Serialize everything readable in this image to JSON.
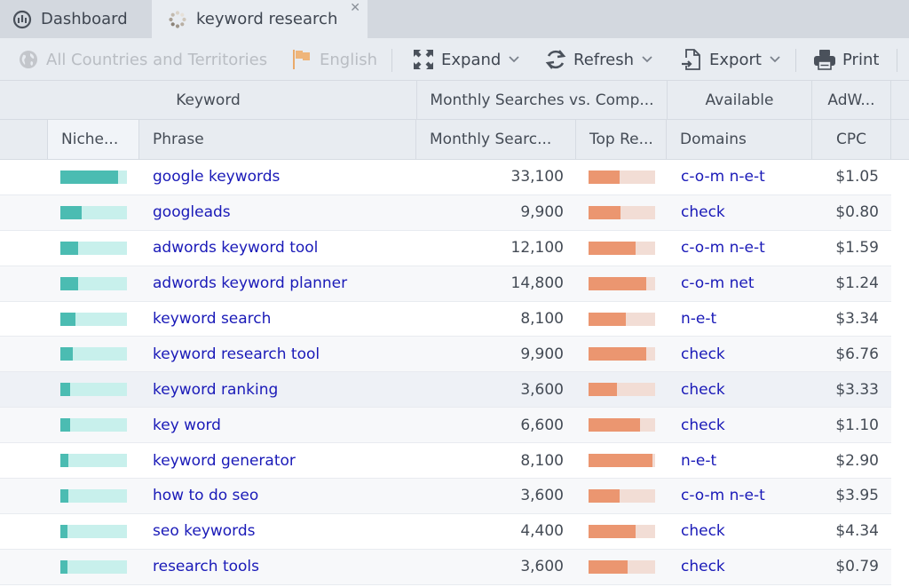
{
  "tabs": [
    {
      "label": "Dashboard",
      "icon": "dashboard-gauge-icon",
      "active": false
    },
    {
      "label": "keyword research",
      "icon": "loading-spinner-icon",
      "active": true,
      "closable": true
    }
  ],
  "toolbar": {
    "country": {
      "label": "All Countries and Territories",
      "icon": "globe-icon",
      "enabled": false
    },
    "language": {
      "label": "English",
      "icon": "flag-icon",
      "enabled": false
    },
    "expand": {
      "label": "Expand",
      "icon": "expand-arrows-icon",
      "has_dropdown": true
    },
    "refresh": {
      "label": "Refresh",
      "icon": "refresh-icon",
      "has_dropdown": true
    },
    "export": {
      "label": "Export",
      "icon": "export-file-icon",
      "has_dropdown": true
    },
    "print": {
      "label": "Print",
      "icon": "printer-icon",
      "has_dropdown": false
    }
  },
  "table": {
    "group_headers": [
      "Keyword",
      "Monthly Searches vs. Comp...",
      "Available",
      "AdW..."
    ],
    "columns": [
      "Niche...",
      "Phrase",
      "Monthly Searc...",
      "Top Re...",
      "Domains",
      "CPC"
    ],
    "selected_row": 6,
    "rows": [
      {
        "niche": 0.87,
        "phrase": "google keywords",
        "searches": "33,100",
        "top": 0.46,
        "domains": "c-o-m n-e-t",
        "cpc": "$1.05"
      },
      {
        "niche": 0.32,
        "phrase": "googleads",
        "searches": "9,900",
        "top": 0.48,
        "domains": "check",
        "cpc": "$0.80"
      },
      {
        "niche": 0.26,
        "phrase": "adwords keyword tool",
        "searches": "12,100",
        "top": 0.7,
        "domains": "c-o-m n-e-t",
        "cpc": "$1.59"
      },
      {
        "niche": 0.26,
        "phrase": "adwords keyword planner",
        "searches": "14,800",
        "top": 0.86,
        "domains": "c-o-m net",
        "cpc": "$1.24"
      },
      {
        "niche": 0.22,
        "phrase": "keyword search",
        "searches": "8,100",
        "top": 0.56,
        "domains": "n-e-t",
        "cpc": "$3.34"
      },
      {
        "niche": 0.18,
        "phrase": "keyword research tool",
        "searches": "9,900",
        "top": 0.86,
        "domains": "check",
        "cpc": "$6.76"
      },
      {
        "niche": 0.14,
        "phrase": "keyword ranking",
        "searches": "3,600",
        "top": 0.42,
        "domains": "check",
        "cpc": "$3.33"
      },
      {
        "niche": 0.14,
        "phrase": "key word",
        "searches": "6,600",
        "top": 0.77,
        "domains": "check",
        "cpc": "$1.10"
      },
      {
        "niche": 0.12,
        "phrase": "keyword generator",
        "searches": "8,100",
        "top": 0.96,
        "domains": "n-e-t",
        "cpc": "$2.90"
      },
      {
        "niche": 0.12,
        "phrase": "how to do seo",
        "searches": "3,600",
        "top": 0.46,
        "domains": "c-o-m n-e-t",
        "cpc": "$3.95"
      },
      {
        "niche": 0.1,
        "phrase": "seo keywords",
        "searches": "4,400",
        "top": 0.7,
        "domains": "check",
        "cpc": "$4.34"
      },
      {
        "niche": 0.1,
        "phrase": "research tools",
        "searches": "3,600",
        "top": 0.58,
        "domains": "check",
        "cpc": "$0.79"
      }
    ]
  },
  "colors": {
    "niche_fill": "#4bbcb2",
    "niche_track": "#c8f0ec",
    "top_fill": "#eb9670",
    "top_track": "#f2ddd5",
    "link": "#1a1ab8"
  }
}
